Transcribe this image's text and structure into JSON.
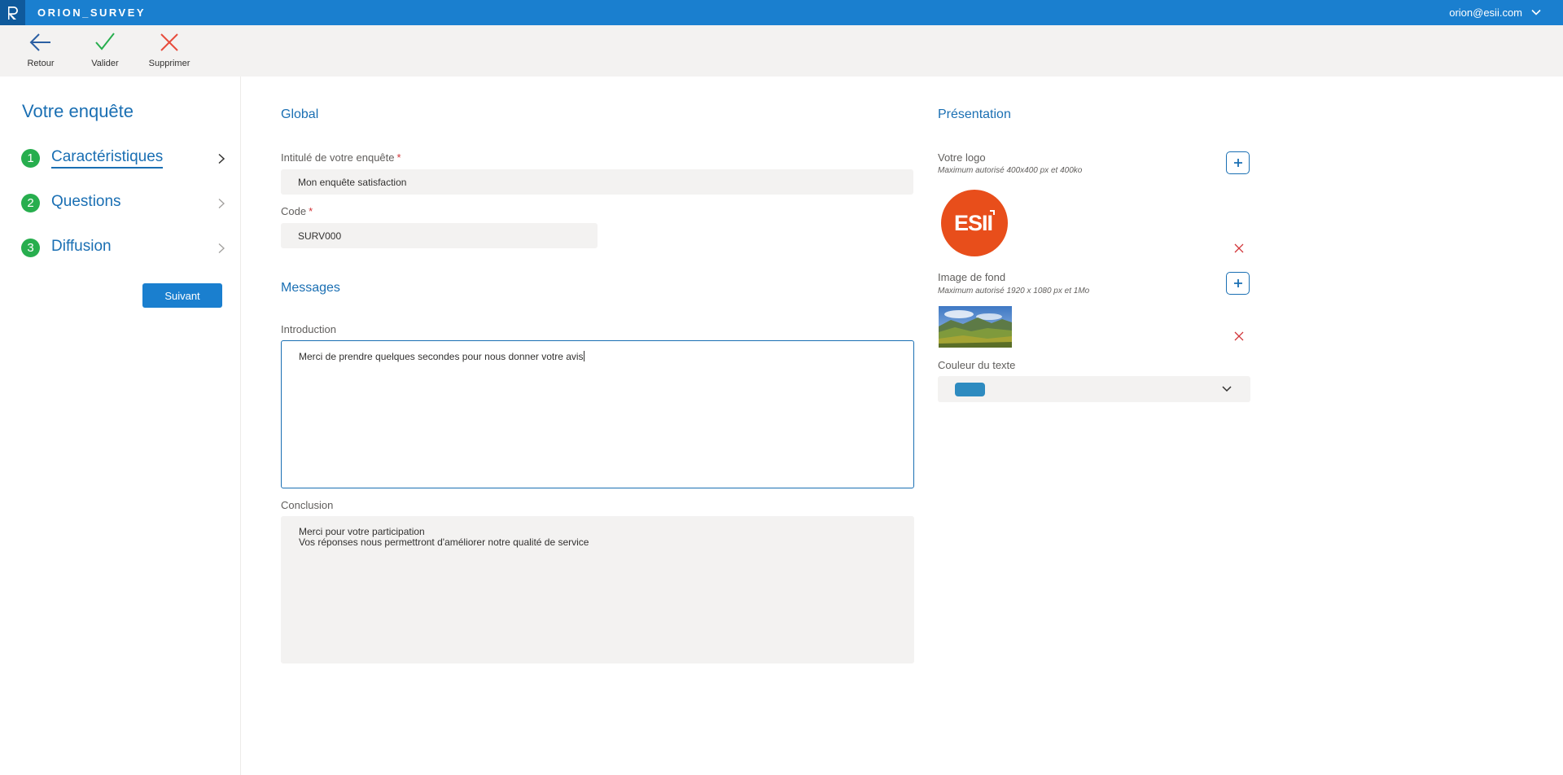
{
  "app": {
    "name": "ORION_SURVEY",
    "user": "orion@esii.com"
  },
  "toolbar": {
    "back_label": "Retour",
    "validate_label": "Valider",
    "delete_label": "Supprimer"
  },
  "sidebar": {
    "title": "Votre enquête",
    "steps": [
      {
        "number": "1",
        "label": "Caractéristiques",
        "active": true
      },
      {
        "number": "2",
        "label": "Questions",
        "active": false
      },
      {
        "number": "3",
        "label": "Diffusion",
        "active": false
      }
    ],
    "next_label": "Suivant"
  },
  "global": {
    "title": "Global",
    "survey_title_label": "Intitulé de votre enquête",
    "survey_title_value": "Mon enquête satisfaction",
    "code_label": "Code",
    "code_value": "SURV000",
    "required_mark": "*"
  },
  "messages": {
    "title": "Messages",
    "intro_label": "Introduction",
    "intro_value": "Merci de prendre quelques secondes pour nous donner votre avis",
    "conclusion_label": "Conclusion",
    "conclusion_value": "Merci pour votre participation\nVos réponses nous permettront d'améliorer notre qualité de service"
  },
  "presentation": {
    "title": "Présentation",
    "logo_label": "Votre logo",
    "logo_hint": "Maximum autorisé 400x400 px et 400ko",
    "logo_text": "ESII",
    "background_label": "Image de fond",
    "background_hint": "Maximum autorisé 1920 x 1080 px et 1Mo",
    "text_color_label": "Couleur du texte",
    "text_color": "#2e8bc0"
  },
  "colors": {
    "brand": "#1a7fcf",
    "accent": "#1a6fb3",
    "step_badge": "#27ae4e",
    "danger": "#d13438",
    "logo_bg": "#e84e1b"
  }
}
